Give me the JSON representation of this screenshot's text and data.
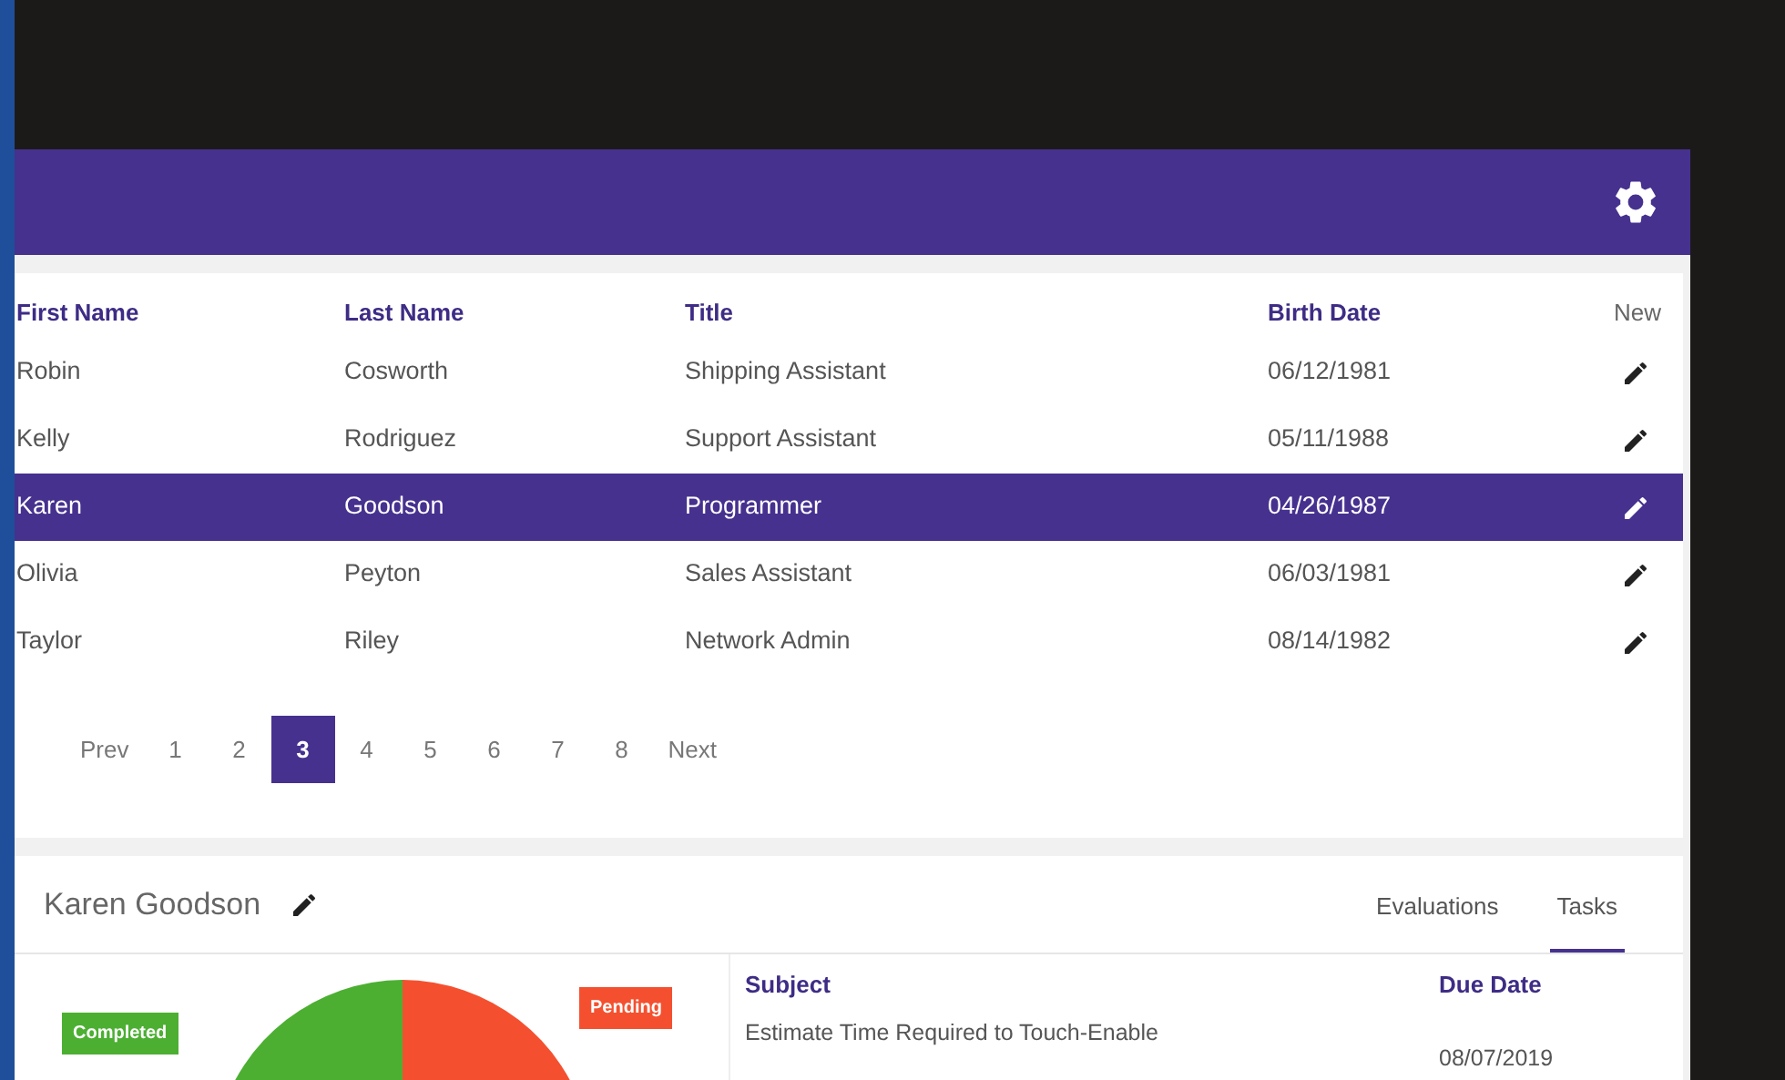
{
  "table": {
    "columns": [
      "First Name",
      "Last Name",
      "Title",
      "Birth Date"
    ],
    "new_label": "New",
    "rows": [
      {
        "cells": [
          "Robin",
          "Cosworth",
          "Shipping Assistant",
          "06/12/1981"
        ],
        "selected": false
      },
      {
        "cells": [
          "Kelly",
          "Rodriguez",
          "Support Assistant",
          "05/11/1988"
        ],
        "selected": false
      },
      {
        "cells": [
          "Karen",
          "Goodson",
          "Programmer",
          "04/26/1987"
        ],
        "selected": true
      },
      {
        "cells": [
          "Olivia",
          "Peyton",
          "Sales Assistant",
          "06/03/1981"
        ],
        "selected": false
      },
      {
        "cells": [
          "Taylor",
          "Riley",
          "Network Admin",
          "08/14/1982"
        ],
        "selected": false
      }
    ]
  },
  "pagination": {
    "prev": "Prev",
    "next": "Next",
    "pages": [
      {
        "label": "1",
        "selected": false
      },
      {
        "label": "2",
        "selected": false
      },
      {
        "label": "3",
        "selected": true
      },
      {
        "label": "4",
        "selected": false
      },
      {
        "label": "5",
        "selected": false
      },
      {
        "label": "6",
        "selected": false
      },
      {
        "label": "7",
        "selected": false
      },
      {
        "label": "8",
        "selected": false
      }
    ]
  },
  "detail": {
    "name": "Karen Goodson",
    "tabs": [
      {
        "label": "Evaluations",
        "selected": false
      },
      {
        "label": "Tasks",
        "selected": true
      }
    ],
    "legend": [
      {
        "label": "Completed",
        "color": "#4caf32"
      },
      {
        "label": "Pending",
        "color": "#f4502f"
      }
    ],
    "tasks": {
      "columns": [
        "Subject",
        "Due Date"
      ],
      "rows": [
        {
          "cells": [
            "Estimate Time Required to Touch-Enable",
            "08/07/2019"
          ]
        }
      ]
    }
  }
}
